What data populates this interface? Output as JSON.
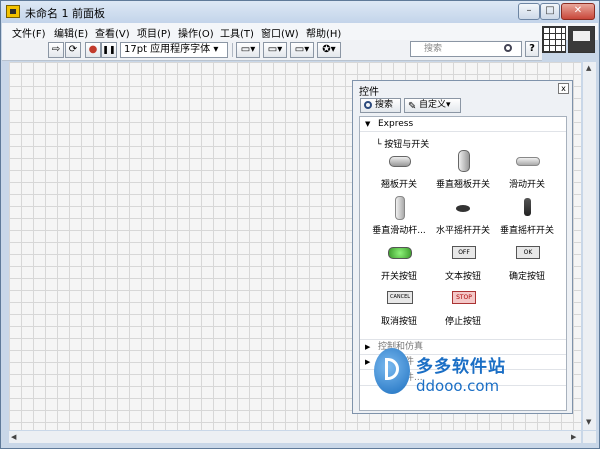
{
  "window": {
    "title": "未命名 1 前面板",
    "min": "–",
    "max": "□",
    "close": "✕"
  },
  "menu": [
    {
      "label": "文件(F)"
    },
    {
      "label": "编辑(E)"
    },
    {
      "label": "查看(V)"
    },
    {
      "label": "项目(P)"
    },
    {
      "label": "操作(O)"
    },
    {
      "label": "工具(T)"
    },
    {
      "label": "窗口(W)"
    },
    {
      "label": "帮助(H)"
    }
  ],
  "toolbar": {
    "run": "⇨",
    "run_continuous": "⟳",
    "abort": "●",
    "pause": "❚❚",
    "font": "17pt 应用程序字体 ▾",
    "align": "▭▾",
    "distribute": "▭▾",
    "resize": "▭▾",
    "reorder": "✪▾",
    "search_placeholder": "搜索",
    "help": "?"
  },
  "palette": {
    "title": "控件",
    "close": "x",
    "search_label": "搜索",
    "customize_label": "自定义▾",
    "express": "Express",
    "subcategory": "└ 按钮与开关",
    "items": [
      {
        "label": "翘板开关"
      },
      {
        "label": "垂直翘板开关"
      },
      {
        "label": "滑动开关"
      },
      {
        "label": "垂直滑动杆..."
      },
      {
        "label": "水平摇杆开关"
      },
      {
        "label": "垂直摇杆开关"
      },
      {
        "label": "开关按钮"
      },
      {
        "label": "文本按钮",
        "text": "OFF"
      },
      {
        "label": "确定按钮",
        "text": "OK"
      },
      {
        "label": "取消按钮",
        "text": "CANCEL"
      },
      {
        "label": "停止按钮",
        "text": "STOP"
      }
    ],
    "collapsed": [
      {
        "label": "控制和仿真"
      },
      {
        "label": "用户控件"
      },
      {
        "label": "选择控件..."
      }
    ]
  },
  "watermark": {
    "name": "多多软件站",
    "url": "ddooo.com"
  }
}
